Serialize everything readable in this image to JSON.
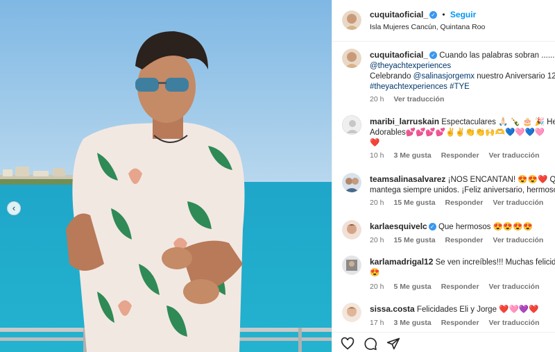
{
  "post": {
    "username": "cuquitaoficial_",
    "follow_label": "Seguir",
    "separator": "•",
    "location": "Isla Mujeres Cancún, Quintana Roo",
    "prev_icon": "chevron-left-icon"
  },
  "caption": {
    "username": "cuquitaoficial_",
    "line1_text": "Cuando las palabras sobran .......",
    "line2_mention": "@theyachtexperiences",
    "line3_prefix": "Celebrando",
    "line3_mention": "@salinasjorgemx",
    "line3_suffix": "nuestro Aniversario 12",
    "line4_tag1": "#theyachtexperiences",
    "line4_tag2": "#TYE",
    "time": "20 h",
    "translate": "Ver traducción"
  },
  "comments": [
    {
      "username": "maribi_larruskain",
      "text": "Espectaculares 🙏🏻 🍾 🎂 🎉 Hermosos",
      "text2": "Adorables💕💕💕💕✌️✌️👏👏🙌🫶💙🩷💙🩷",
      "text3": "❤️",
      "time": "10 h",
      "likes": "3 Me gusta",
      "reply": "Responder",
      "translate": "Ver traducción"
    },
    {
      "username": "teamsalinasalvarez",
      "text": "¡NOS ENCANTAN! 😍😍❤️ Que D",
      "text2": "mantega siempre unidos. ¡Feliz aniversario, hermosos!",
      "time": "20 h",
      "likes": "15 Me gusta",
      "reply": "Responder",
      "translate": "Ver traducción"
    },
    {
      "username": "karlaesquivelc",
      "text": "Que hermosos 😍😍😍😍",
      "time": "20 h",
      "likes": "15 Me gusta",
      "reply": "Responder",
      "translate": "Ver traducción"
    },
    {
      "username": "karlamadrigal12",
      "text": "Se ven increíbles!!! Muchas felicidade",
      "text2": "😍",
      "time": "20 h",
      "likes": "5 Me gusta",
      "reply": "Responder",
      "translate": "Ver traducción"
    },
    {
      "username": "sissa.costa",
      "text": "Felicidades Eli y Jorge ❤️🩷💜❤️",
      "time": "17 h",
      "likes": "3 Me gusta",
      "reply": "Responder",
      "translate": "Ver traducción"
    }
  ],
  "actions": [
    "heart-icon",
    "comment-icon",
    "share-icon"
  ],
  "colors": {
    "accent": "#0095f6",
    "link": "#00376b",
    "muted": "#737373",
    "verified": "#3897f0"
  }
}
